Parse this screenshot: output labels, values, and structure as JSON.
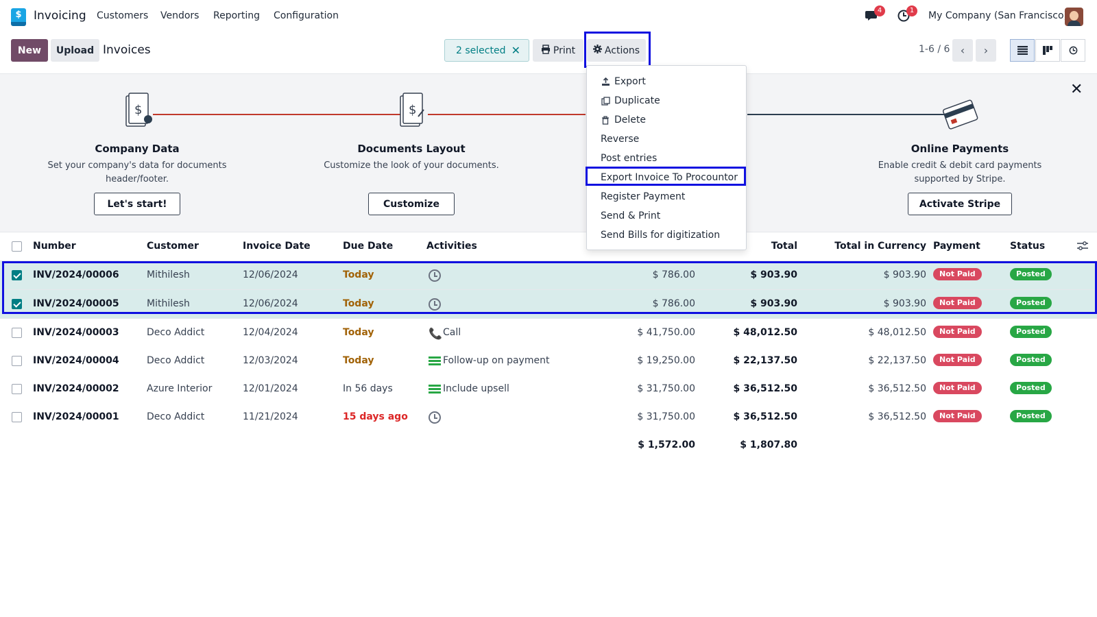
{
  "app": {
    "name": "Invoicing",
    "logo_symbol": "$"
  },
  "nav": {
    "menus": [
      "Customers",
      "Vendors",
      "Reporting",
      "Configuration"
    ],
    "chat_badge": "4",
    "activity_badge": "1",
    "company": "My Company (San Francisco)"
  },
  "control": {
    "new_label": "New",
    "upload_label": "Upload",
    "breadcrumb": "Invoices",
    "selected_label": "2 selected",
    "print_label": "Print",
    "actions_label": "Actions",
    "pager": "1-6 / 6"
  },
  "banner": {
    "steps": [
      {
        "title": "Company Data",
        "desc_line1": "Set your company's data for documents",
        "desc_line2": "header/footer.",
        "button": "Let's start!"
      },
      {
        "title": "Documents Layout",
        "desc_line1": "Customize the look of your documents.",
        "desc_line2": "",
        "button": "Customize"
      },
      {
        "title": "Online Payments",
        "desc_line1": "Enable credit & debit card payments",
        "desc_line2": "supported by Stripe.",
        "button": "Activate Stripe"
      }
    ]
  },
  "actions_menu": {
    "items": [
      {
        "label": "Export",
        "icon": "upload-icon"
      },
      {
        "label": "Duplicate",
        "icon": "copy-icon"
      },
      {
        "label": "Delete",
        "icon": "trash-icon"
      },
      {
        "label": "Reverse",
        "icon": ""
      },
      {
        "label": "Post entries",
        "icon": ""
      },
      {
        "label": "Export Invoice To Procountor",
        "icon": ""
      },
      {
        "label": "Register Payment",
        "icon": ""
      },
      {
        "label": "Send & Print",
        "icon": ""
      },
      {
        "label": "Send Bills for digitization",
        "icon": ""
      }
    ]
  },
  "table": {
    "headers": {
      "number": "Number",
      "customer": "Customer",
      "invoice_date": "Invoice Date",
      "due_date": "Due Date",
      "activities": "Activities",
      "total": "Total",
      "total_currency": "Total in Currency",
      "payment": "Payment",
      "status": "Status"
    },
    "rows": [
      {
        "number": "INV/2024/00006",
        "customer": "Mithilesh",
        "invoice_date": "12/06/2024",
        "due": "Today",
        "activity": "",
        "untaxed": "$ 786.00",
        "total": "$ 903.90",
        "total_currency": "$ 903.90",
        "payment": "Not Paid",
        "status": "Posted"
      },
      {
        "number": "INV/2024/00005",
        "customer": "Mithilesh",
        "invoice_date": "12/06/2024",
        "due": "Today",
        "activity": "",
        "untaxed": "$ 786.00",
        "total": "$ 903.90",
        "total_currency": "$ 903.90",
        "payment": "Not Paid",
        "status": "Posted"
      },
      {
        "number": "INV/2024/00003",
        "customer": "Deco Addict",
        "invoice_date": "12/04/2024",
        "due": "Today",
        "activity": "Call",
        "untaxed": "$ 41,750.00",
        "total": "$ 48,012.50",
        "total_currency": "$ 48,012.50",
        "payment": "Not Paid",
        "status": "Posted"
      },
      {
        "number": "INV/2024/00004",
        "customer": "Deco Addict",
        "invoice_date": "12/03/2024",
        "due": "Today",
        "activity": "Follow-up on payment",
        "untaxed": "$ 19,250.00",
        "total": "$ 22,137.50",
        "total_currency": "$ 22,137.50",
        "payment": "Not Paid",
        "status": "Posted"
      },
      {
        "number": "INV/2024/00002",
        "customer": "Azure Interior",
        "invoice_date": "12/01/2024",
        "due": "In 56 days",
        "activity": "Include upsell",
        "untaxed": "$ 31,750.00",
        "total": "$ 36,512.50",
        "total_currency": "$ 36,512.50",
        "payment": "Not Paid",
        "status": "Posted"
      },
      {
        "number": "INV/2024/00001",
        "customer": "Deco Addict",
        "invoice_date": "11/21/2024",
        "due": "15 days ago",
        "activity": "",
        "untaxed": "$ 31,750.00",
        "total": "$ 36,512.50",
        "total_currency": "$ 36,512.50",
        "payment": "Not Paid",
        "status": "Posted"
      }
    ],
    "totals": {
      "untaxed": "$ 1,572.00",
      "total": "$ 1,807.80"
    }
  },
  "colors": {
    "brand": "#714b67",
    "selection": "#017e84",
    "highlight_box": "#1010e0",
    "not_paid": "#d9485f",
    "posted": "#28a745"
  }
}
